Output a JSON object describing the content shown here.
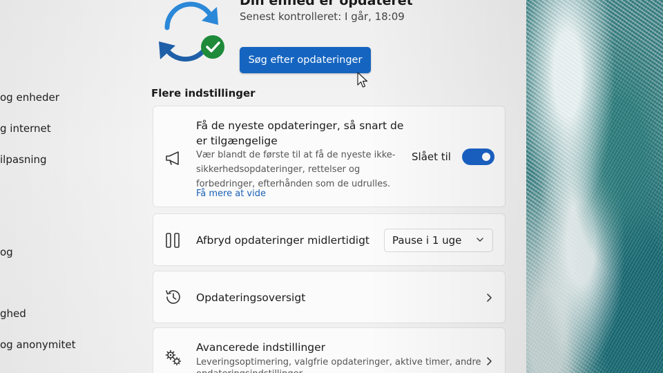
{
  "nav": {
    "items": [
      {
        "label": "og enheder"
      },
      {
        "label": "g internet"
      },
      {
        "label": "ilpasning"
      },
      {
        "label": "og"
      },
      {
        "label": "ghed"
      },
      {
        "label": "og anonymitet"
      }
    ]
  },
  "hero": {
    "title": "Din enhed er opdateret",
    "subtitle": "Senest kontrolleret: I går, 18:09",
    "check_button": "Søg efter opdateringer",
    "icon": "sync-check-icon"
  },
  "more_settings": {
    "heading": "Flere indstillinger",
    "latest_updates": {
      "title_line1": "Få de nyeste opdateringer, så snart de",
      "title_line2": "er tilgængelige",
      "desc_line1": "Vær blandt de første til at få de nyeste ikke-",
      "desc_line2": "sikkerhedsopdateringer, rettelser og",
      "desc_line3": "forbedringer, efterhånden som de udrulles.",
      "link": "Få mere at vide",
      "toggle_label": "Slået til",
      "toggle_on": true,
      "icon": "megaphone-icon"
    },
    "pause": {
      "title": "Afbryd opdateringer midlertidigt",
      "dropdown_value": "Pause i 1 uge",
      "icon": "pause-icon"
    },
    "history": {
      "title": "Opdateringsoversigt",
      "icon": "history-icon"
    },
    "advanced": {
      "title": "Avancerede indstillinger",
      "desc_line1": "Leveringsoptimering, valgfrie opdateringer, aktive timer, andre",
      "desc_line2": "opdateringsindstillinger",
      "icon": "gears-icon"
    }
  },
  "colors": {
    "accent": "#1565c0",
    "toggle_on": "#1a62c5",
    "check_green": "#1e8a3a",
    "sync_blue": "#2b88d8"
  }
}
